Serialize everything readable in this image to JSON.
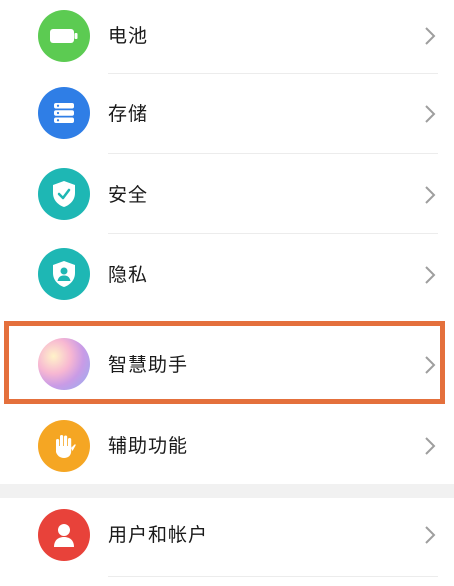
{
  "settings": {
    "items": [
      {
        "label": "电池",
        "icon": "battery-icon",
        "color": "#5ccb52"
      },
      {
        "label": "存储",
        "icon": "storage-icon",
        "color": "#2f7ee6"
      },
      {
        "label": "安全",
        "icon": "shield-check-icon",
        "color": "#1eb7b4"
      },
      {
        "label": "隐私",
        "icon": "privacy-shield-icon",
        "color": "#1eb7b4"
      },
      {
        "label": "智慧助手",
        "icon": "smart-assistant-icon",
        "color": "#c88ee6"
      },
      {
        "label": "辅助功能",
        "icon": "hand-icon",
        "color": "#f5a623"
      },
      {
        "label": "用户和帐户",
        "icon": "user-icon",
        "color": "#e8423a"
      }
    ]
  },
  "highlight": {
    "color": "#e4703c",
    "target": "智慧助手"
  }
}
